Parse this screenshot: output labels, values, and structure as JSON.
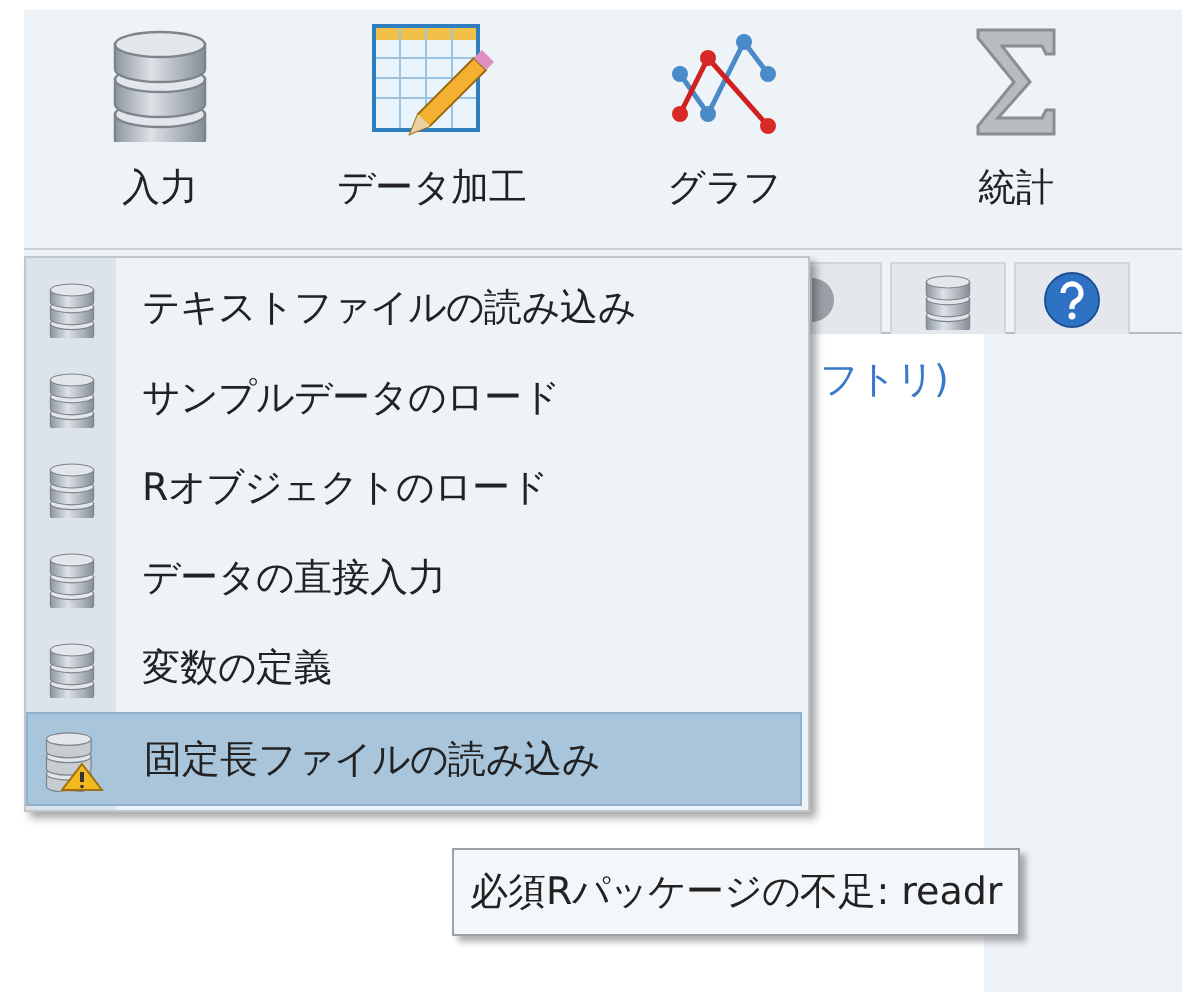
{
  "toolbar": [
    {
      "label": "入力"
    },
    {
      "label": "データ加工"
    },
    {
      "label": "グラフ"
    },
    {
      "label": "統計"
    }
  ],
  "panel": {
    "text": "フトリ)"
  },
  "menu": [
    {
      "label": "テキストファイルの読み込み",
      "selected": false,
      "warning": false
    },
    {
      "label": "サンプルデータのロード",
      "selected": false,
      "warning": false
    },
    {
      "label": "Rオブジェクトのロード",
      "selected": false,
      "warning": false
    },
    {
      "label": "データの直接入力",
      "selected": false,
      "warning": false
    },
    {
      "label": "変数の定義",
      "selected": false,
      "warning": false
    },
    {
      "label": "固定長ファイルの読み込み",
      "selected": true,
      "warning": true
    }
  ],
  "tooltip": "必須Rパッケージの不足: readr"
}
